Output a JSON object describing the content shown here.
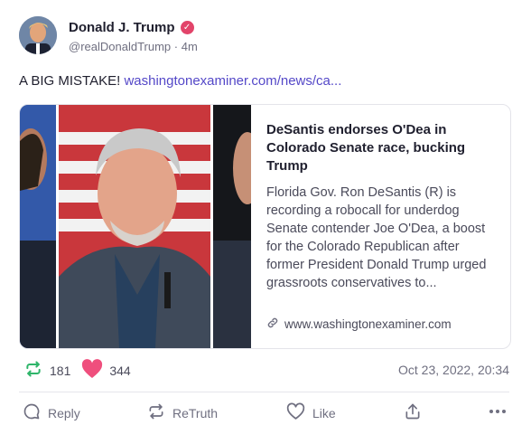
{
  "author": {
    "name": "Donald J. Trump",
    "handle": "@realDonaldTrump",
    "separator": "·",
    "time_ago": "4m",
    "verified_color": "#e2446a"
  },
  "post": {
    "text": "A BIG MISTAKE!",
    "link_text": "washingtonexaminer.com/news/ca..."
  },
  "card": {
    "title": "DeSantis endorses O'Dea in Colorado Senate race, bucking Trump",
    "description": "Florida Gov. Ron DeSantis (R) is recording a robocall for underdog Senate contender Joe O'Dea, a boost for the Colorado Republican after former President Donald Trump urged grassroots conservatives to...",
    "domain": "www.washingtonexaminer.com"
  },
  "stats": {
    "retruths": "181",
    "likes": "344",
    "timestamp": "Oct 23, 2022, 20:34",
    "retruth_color": "#2fb56a",
    "like_color": "#ef4f7d"
  },
  "actions": {
    "reply": "Reply",
    "retruth": "ReTruth",
    "like": "Like"
  }
}
